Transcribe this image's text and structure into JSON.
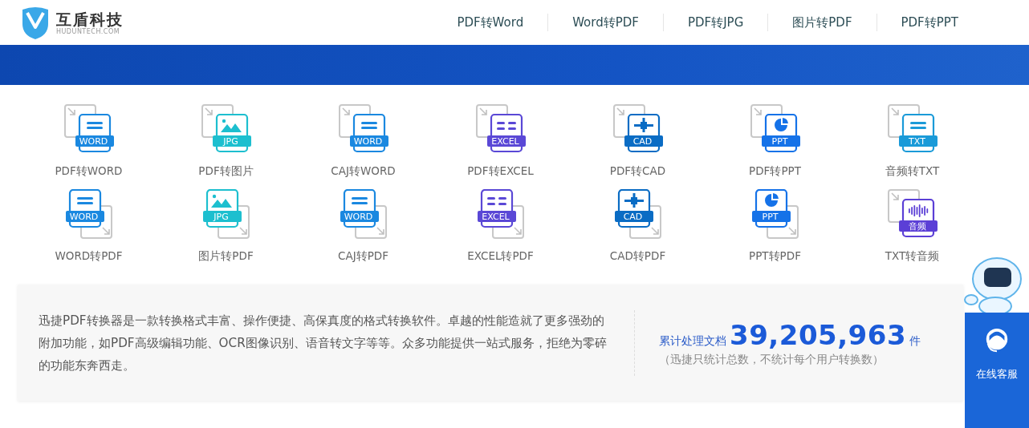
{
  "header": {
    "brand": "互盾科技",
    "brand_sub": "HUDUNTECH.COM",
    "nav": [
      {
        "label": "PDF转Word"
      },
      {
        "label": "Word转PDF"
      },
      {
        "label": "PDF转JPG"
      },
      {
        "label": "图片转PDF"
      },
      {
        "label": "PDF转PPT"
      }
    ]
  },
  "tools": [
    {
      "label": "PDF转WORD",
      "badge": "WORD",
      "reversed": false,
      "kind": "lines",
      "color": "#1a88e0"
    },
    {
      "label": "PDF转图片",
      "badge": "JPG",
      "reversed": false,
      "kind": "image",
      "color": "#1dbfcf"
    },
    {
      "label": "CAJ转WORD",
      "badge": "WORD",
      "reversed": false,
      "kind": "lines",
      "color": "#1a88e0"
    },
    {
      "label": "PDF转EXCEL",
      "badge": "EXCEL",
      "reversed": false,
      "kind": "table",
      "color": "#5a48d6"
    },
    {
      "label": "PDF转CAD",
      "badge": "CAD",
      "reversed": false,
      "kind": "cad",
      "color": "#0a6cc4"
    },
    {
      "label": "PDF转PPT",
      "badge": "PPT",
      "reversed": false,
      "kind": "pie",
      "color": "#1572e8"
    },
    {
      "label": "音频转TXT",
      "badge": "TXT",
      "reversed": false,
      "kind": "lines",
      "color": "#1a9ad8"
    },
    {
      "label": "WORD转PDF",
      "badge": "WORD",
      "reversed": true,
      "kind": "lines",
      "color": "#1a88e0"
    },
    {
      "label": "图片转PDF",
      "badge": "JPG",
      "reversed": true,
      "kind": "image",
      "color": "#1dbfcf"
    },
    {
      "label": "CAJ转PDF",
      "badge": "WORD",
      "reversed": true,
      "kind": "lines",
      "color": "#1a88e0"
    },
    {
      "label": "EXCEL转PDF",
      "badge": "EXCEL",
      "reversed": true,
      "kind": "table",
      "color": "#5a48d6"
    },
    {
      "label": "CAD转PDF",
      "badge": "CAD",
      "reversed": true,
      "kind": "cad",
      "color": "#0a6cc4"
    },
    {
      "label": "PPT转PDF",
      "badge": "PPT",
      "reversed": true,
      "kind": "pie",
      "color": "#1572e8"
    },
    {
      "label": "TXT转音频",
      "badge": "音频",
      "reversed": false,
      "kind": "audio",
      "color": "#5b3fd6"
    }
  ],
  "info": {
    "description": "迅捷PDF转换器是一款转换格式丰富、操作便捷、高保真度的格式转换软件。卓越的性能造就了更多强劲的附加功能，如PDF高级编辑功能、OCR图像识别、语音转文字等等。众多功能提供一站式服务，拒绝为零碎的功能东奔西走。",
    "stat_label": "累计处理文档",
    "stat_value": "39,205,963",
    "stat_unit": "件",
    "stat_note": "（迅捷只统计总数，不统计每个用户转换数）"
  },
  "service": {
    "label": "在线客服"
  }
}
